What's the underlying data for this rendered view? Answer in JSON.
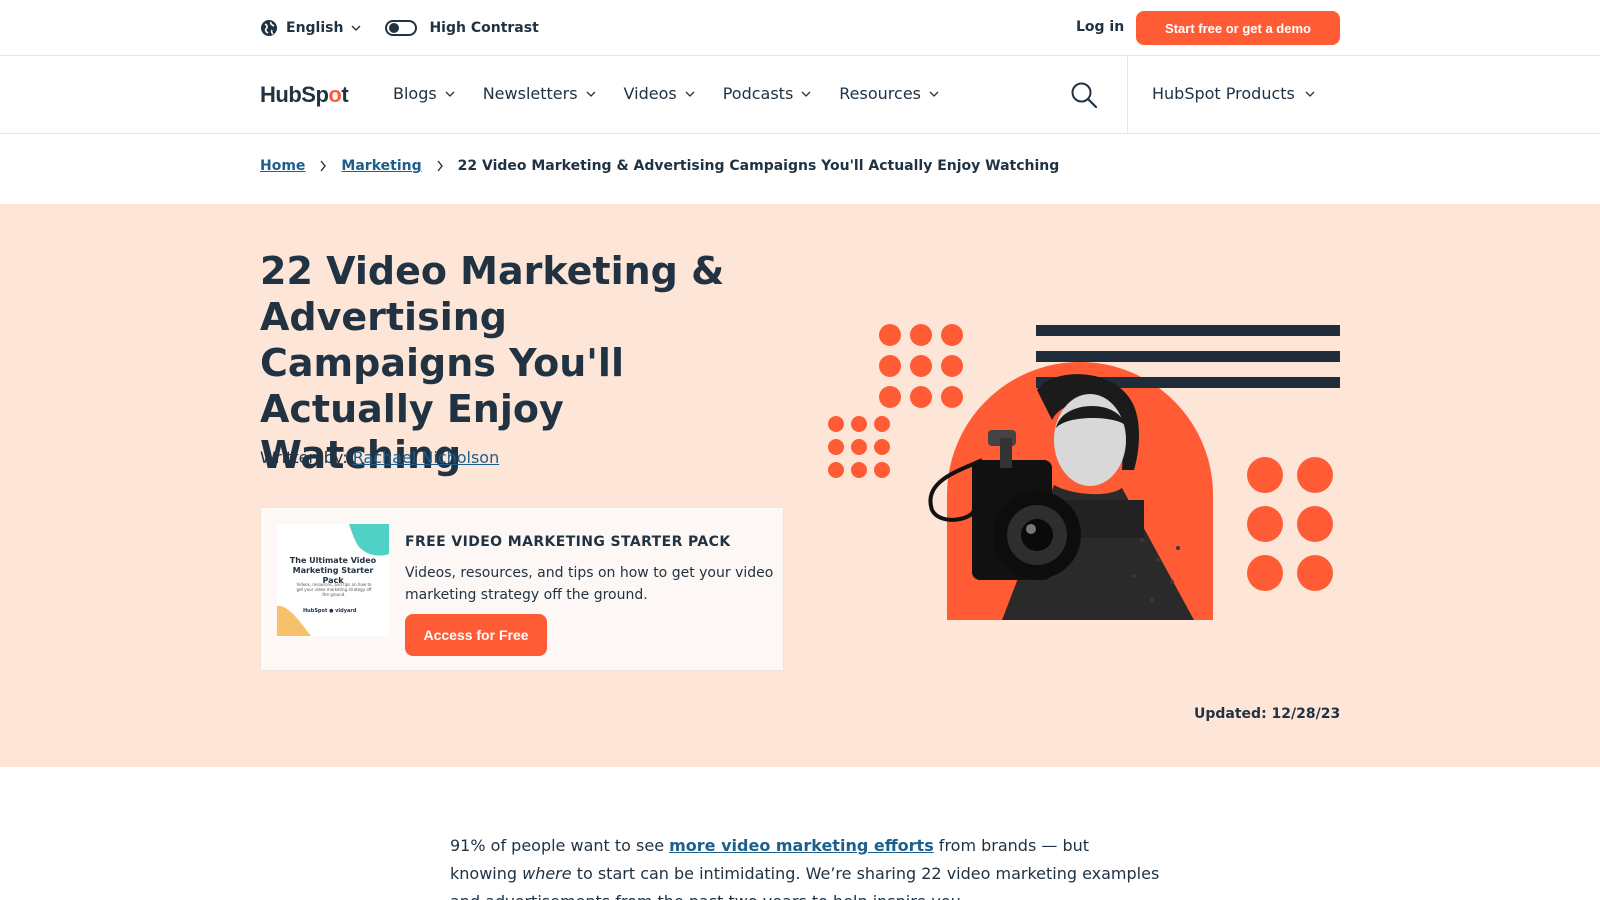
{
  "utility": {
    "language": "English",
    "contrast_label": "High Contrast",
    "login": "Log in",
    "cta": "Start free or get a demo"
  },
  "nav": {
    "logo_prefix": "HubSp",
    "logo_o": "o",
    "logo_suffix": "t",
    "items": [
      {
        "label": "Blogs"
      },
      {
        "label": "Newsletters"
      },
      {
        "label": "Videos"
      },
      {
        "label": "Podcasts"
      },
      {
        "label": "Resources"
      }
    ],
    "products": "HubSpot Products"
  },
  "breadcrumb": {
    "home": "Home",
    "marketing": "Marketing",
    "current": "22 Video Marketing & Advertising Campaigns You'll Actually Enjoy Watching"
  },
  "hero": {
    "title": "22 Video Marketing & Advertising Campaigns You'll Actually Enjoy Watching",
    "byline_prefix": "Written by: ",
    "author": "Rachael Nicholson",
    "updated_label": "Updated: ",
    "updated_date": "12/28/23"
  },
  "offer": {
    "thumb_title": "The Ultimate Video Marketing Starter Pack",
    "thumb_sub": "Videos, resources, and tips on how to get your video marketing strategy off the ground.",
    "thumb_logos": "HubSpot  ● vidyard",
    "title": "FREE VIDEO MARKETING STARTER PACK",
    "description": "Videos, resources, and tips on how to get your video marketing strategy off the ground.",
    "button": "Access for Free"
  },
  "article": {
    "p1_a": "91% of people want to see ",
    "p1_link": "more video marketing efforts",
    "p1_b": " from brands — but knowing ",
    "p1_em": "where",
    "p1_c": " to start can be intimidating. We’re sharing 22 video marketing examples and advertisements from the past two years to help inspire you."
  },
  "colors": {
    "brand_orange": "#ff5c35",
    "navy": "#213343",
    "hero_bg": "#fde6d7",
    "link": "#1c5f8c"
  },
  "icons": [
    "globe-icon",
    "chevron-down-icon",
    "toggle-switch",
    "search-icon",
    "chevron-right-icon"
  ]
}
